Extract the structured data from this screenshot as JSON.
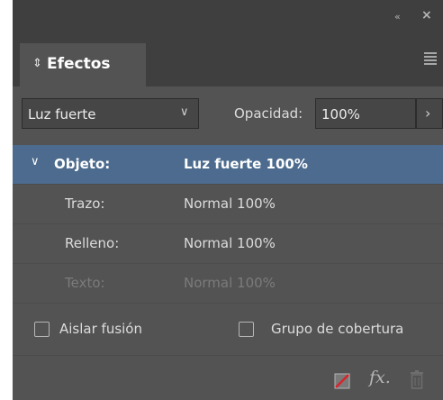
{
  "panel": {
    "tab_title": "Efectos",
    "collapse_glyph": "«",
    "close_glyph": "×"
  },
  "controls": {
    "blend_mode": "Luz fuerte",
    "opacity_label": "Opacidad:",
    "opacity_value": "100%"
  },
  "rows": [
    {
      "label": "Objeto:",
      "value": "Luz fuerte 100%",
      "state": "selected"
    },
    {
      "label": "Trazo:",
      "value": "Normal 100%",
      "state": "normal"
    },
    {
      "label": "Relleno:",
      "value": "Normal 100%",
      "state": "normal"
    },
    {
      "label": "Texto:",
      "value": "Normal 100%",
      "state": "disabled"
    }
  ],
  "options": {
    "isolate_label": "Aislar fusión",
    "isolate_checked": false,
    "knockout_label": "Grupo de cobertura",
    "knockout_checked": false
  },
  "footer": {
    "fx_label": "fx."
  },
  "colors": {
    "panel_bg": "#535353",
    "header_bg": "#3f3f3f",
    "selection": "#4c6b8e",
    "clear_icon_red": "#d8232a"
  },
  "icons": [
    "collapse-icon",
    "close-icon",
    "tab-toggle-icon",
    "panel-menu-icon",
    "chevron-down-icon",
    "chevron-right-icon",
    "triangle-down-icon",
    "clear-effects-icon",
    "fx-icon",
    "trash-icon"
  ]
}
